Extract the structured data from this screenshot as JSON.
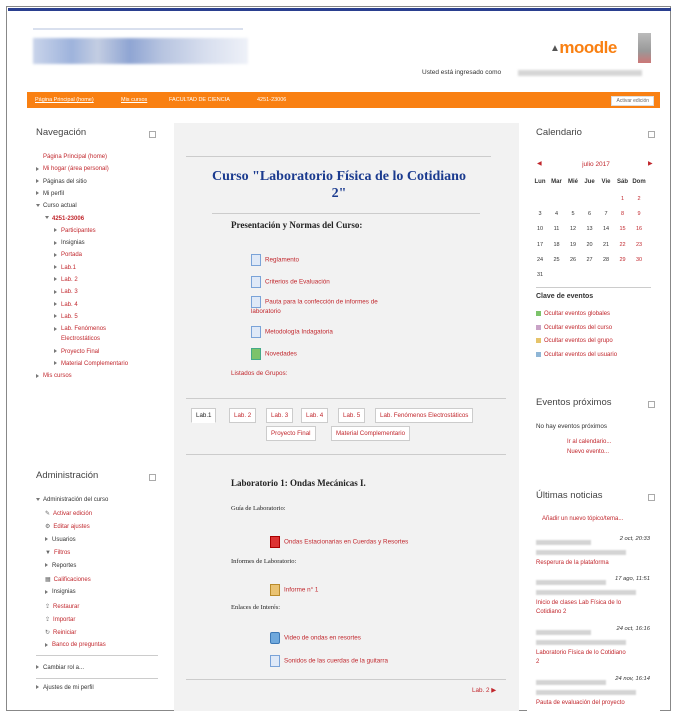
{
  "header": {
    "logged_in_text": "Usted está ingresado como",
    "brand": "moodle",
    "edit_button": "Activar edición"
  },
  "breadcrumb": [
    "Página Principal (home)",
    "Mis cursos",
    "FACULTAD DE CIENCIA",
    "4251-23006"
  ],
  "navigation": {
    "title": "Navegación",
    "items": [
      {
        "label": "Página Principal (home)",
        "color": "red",
        "indent": 0,
        "marker": "none"
      },
      {
        "label": "Mi hogar (área personal)",
        "color": "red",
        "indent": 0,
        "marker": "bullet"
      },
      {
        "label": "Páginas del sitio",
        "color": "dark",
        "indent": 0,
        "marker": "tri"
      },
      {
        "label": "Mi perfil",
        "color": "dark",
        "indent": 0,
        "marker": "tri"
      },
      {
        "label": "Curso actual",
        "color": "dark",
        "indent": 0,
        "marker": "open"
      },
      {
        "label": "4251-23006",
        "color": "red",
        "indent": 1,
        "marker": "open",
        "bold": true
      },
      {
        "label": "Participantes",
        "color": "red",
        "indent": 2,
        "marker": "tri"
      },
      {
        "label": "Insignias",
        "color": "dark",
        "indent": 2,
        "marker": "tri"
      },
      {
        "label": "Portada",
        "color": "red",
        "indent": 2,
        "marker": "tri"
      },
      {
        "label": "Lab.1",
        "color": "red",
        "indent": 2,
        "marker": "tri"
      },
      {
        "label": "Lab. 2",
        "color": "red",
        "indent": 2,
        "marker": "tri"
      },
      {
        "label": "Lab. 3",
        "color": "red",
        "indent": 2,
        "marker": "tri"
      },
      {
        "label": "Lab. 4",
        "color": "red",
        "indent": 2,
        "marker": "tri"
      },
      {
        "label": "Lab. 5",
        "color": "red",
        "indent": 2,
        "marker": "tri"
      },
      {
        "label": "Lab. Fenómenos",
        "color": "red",
        "indent": 2,
        "marker": "tri"
      },
      {
        "label": "Electrostáticos",
        "color": "red",
        "indent": 2,
        "marker": "none"
      },
      {
        "label": "Proyecto Final",
        "color": "red",
        "indent": 2,
        "marker": "tri"
      },
      {
        "label": "Material Complementario",
        "color": "red",
        "indent": 2,
        "marker": "tri"
      },
      {
        "label": "Mis cursos",
        "color": "red",
        "indent": 0,
        "marker": "tri"
      }
    ]
  },
  "administration": {
    "title": "Administración",
    "items": [
      {
        "label": "Administración del curso",
        "color": "dark",
        "indent": 0,
        "marker": "open"
      },
      {
        "label": "Activar edición",
        "color": "red",
        "indent": 1,
        "marker": "pencil"
      },
      {
        "label": "Editar ajustes",
        "color": "red",
        "indent": 1,
        "marker": "gear"
      },
      {
        "label": "Usuarios",
        "color": "dark",
        "indent": 1,
        "marker": "tri"
      },
      {
        "label": "Filtros",
        "color": "red",
        "indent": 1,
        "marker": "filter"
      },
      {
        "label": "Reportes",
        "color": "dark",
        "indent": 1,
        "marker": "tri"
      },
      {
        "label": "Calificaciones",
        "color": "red",
        "indent": 1,
        "marker": "grid"
      },
      {
        "label": "Insignias",
        "color": "dark",
        "indent": 1,
        "marker": "tri"
      },
      {
        "label": "Restaurar",
        "color": "red",
        "indent": 1,
        "marker": "upload"
      },
      {
        "label": "Importar",
        "color": "red",
        "indent": 1,
        "marker": "upload"
      },
      {
        "label": "Reiniciar",
        "color": "red",
        "indent": 1,
        "marker": "reset"
      },
      {
        "label": "Banco de preguntas",
        "color": "red",
        "indent": 1,
        "marker": "tri"
      }
    ],
    "role": "Cambiar rol a...",
    "profile": "Ajustes de mi perfil"
  },
  "course": {
    "title": "Curso \"Laboratorio Física de lo Cotidiano 2\"",
    "section0_heading": "Presentación y Normas del Curso:",
    "section0_resources": [
      {
        "label": "Reglamento",
        "icon": "file"
      },
      {
        "label": "Criterios de Evaluación",
        "icon": "file"
      },
      {
        "label": "Pauta para la confección de informes de",
        "icon": "file"
      },
      {
        "label": "laboratorio",
        "icon": "none"
      },
      {
        "label": "Metodología Indagatoria",
        "icon": "file"
      },
      {
        "label": "Novedades",
        "icon": "forum"
      }
    ],
    "groups": "Listados de Grupos:",
    "tabs": [
      "Lab.1",
      "Lab. 2",
      "Lab. 3",
      "Lab. 4",
      "Lab. 5",
      "Lab. Fenómenos Electrostáticos",
      "Proyecto Final",
      "Material Complementario"
    ],
    "lab_heading": "Laboratorio 1: Ondas Mecánicas I.",
    "guide_label": "Guía de Laboratorio:",
    "guide_link": "Ondas Estacionarias en Cuerdas y Resortes",
    "reports_label": "Informes de Laboratorio:",
    "report_link": "Informe n° 1",
    "links_label": "Enlaces de Interés:",
    "link1": "Video de ondas en resortes",
    "link2": "Sonidos de las cuerdas de la guitarra",
    "next": "Lab. 2"
  },
  "calendar": {
    "title": "Calendario",
    "month": "julio 2017",
    "days": [
      "Lun",
      "Mar",
      "Mié",
      "Jue",
      "Vie",
      "Sáb",
      "Dom"
    ],
    "weeks": [
      [
        "",
        "",
        "",
        "",
        "",
        "1",
        "2"
      ],
      [
        "3",
        "4",
        "5",
        "6",
        "7",
        "8",
        "9"
      ],
      [
        "10",
        "11",
        "12",
        "13",
        "14",
        "15",
        "16"
      ],
      [
        "17",
        "18",
        "19",
        "20",
        "21",
        "22",
        "23"
      ],
      [
        "24",
        "25",
        "26",
        "27",
        "28",
        "29",
        "30"
      ],
      [
        "31",
        "",
        "",
        "",
        "",
        "",
        ""
      ]
    ],
    "events_title": "Clave de eventos",
    "events": [
      {
        "label": "Ocultar eventos globales",
        "color": "#7cc36a"
      },
      {
        "label": "Ocultar eventos del curso",
        "color": "#c9a3c7"
      },
      {
        "label": "Ocultar eventos del grupo",
        "color": "#e6c46a"
      },
      {
        "label": "Ocultar eventos del usuario",
        "color": "#8fb6d6"
      }
    ]
  },
  "upcoming": {
    "title": "Eventos próximos",
    "none": "No hay eventos próximos",
    "calendar_link": "Ir al calendario...",
    "new_event": "Nuevo evento..."
  },
  "news": {
    "title": "Últimas noticias",
    "add": "Añadir un nuevo tópico/tema...",
    "items": [
      {
        "date": "2 oct, 20:33",
        "lines": [
          "Resperura de la plataforma"
        ]
      },
      {
        "date": "17 ago, 11:51",
        "lines": [
          "Inicio de clases Lab Física de lo",
          "Cotidiano 2"
        ]
      },
      {
        "date": "24 oct, 16:16",
        "lines": [
          "Laboratorio Física de lo Cotidiano",
          "2"
        ]
      },
      {
        "date": "24 nov, 16:14",
        "lines": [
          "Pauta de evaluación del proyecto"
        ]
      }
    ]
  }
}
